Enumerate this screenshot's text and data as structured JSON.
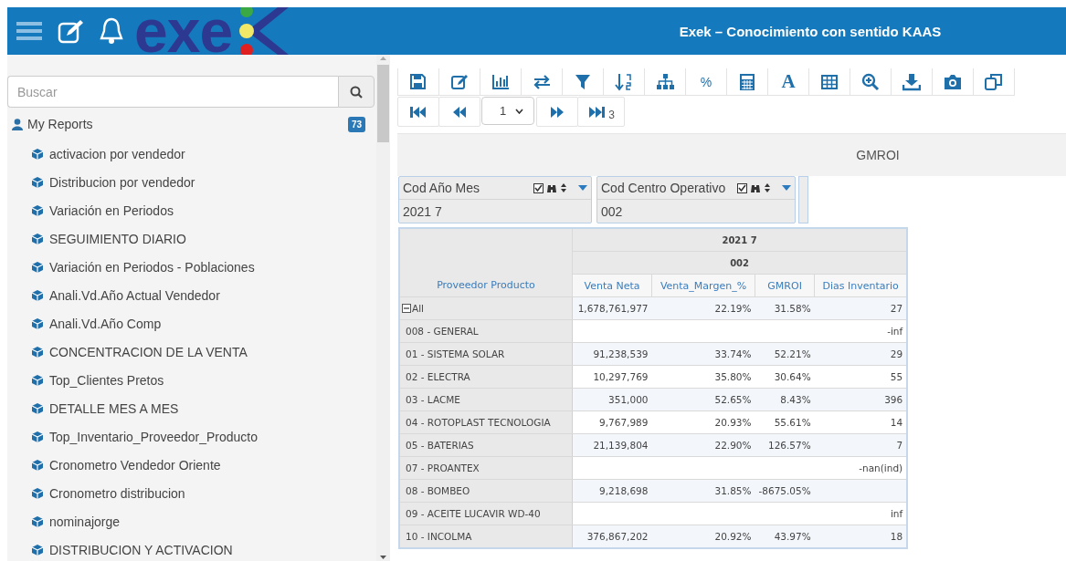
{
  "header": {
    "logo_text": "exe",
    "title": "Exek – Conocimiento con sentido KAAS"
  },
  "sidebar": {
    "search": {
      "placeholder": "Buscar"
    },
    "section": {
      "label": "My Reports",
      "count": "73"
    },
    "items": [
      {
        "label": "activacion por vendedor"
      },
      {
        "label": "Distribucion por vendedor"
      },
      {
        "label": "Variación en Periodos"
      },
      {
        "label": "SEGUIMIENTO DIARIO"
      },
      {
        "label": "Variación en Periodos - Poblaciones"
      },
      {
        "label": "Anali.Vd.Año Actual Vendedor"
      },
      {
        "label": "Anali.Vd.Año Comp"
      },
      {
        "label": "CONCENTRACION DE LA VENTA"
      },
      {
        "label": "Top_Clientes Pretos"
      },
      {
        "label": "DETALLE MES A MES"
      },
      {
        "label": "Top_Inventario_Proveedor_Producto"
      },
      {
        "label": "Cronometro Vendedor Oriente"
      },
      {
        "label": "Cronometro distribucion"
      },
      {
        "label": "nominajorge"
      },
      {
        "label": "DISTRIBUCION Y ACTIVACION"
      }
    ]
  },
  "toolbar": {
    "percent_label": "%",
    "font_label": "A"
  },
  "pager": {
    "page": "1",
    "total": "3"
  },
  "report_title": "GMROI",
  "filters": [
    {
      "label": "Cod Año Mes",
      "value": "2021 7"
    },
    {
      "label": "Cod Centro Operativo",
      "value": "002"
    }
  ],
  "table": {
    "header_rows": [
      "2021 7",
      "002"
    ],
    "row_header": "Proveedor Producto",
    "columns": [
      "Venta Neta",
      "Venta_Margen_%",
      "GMROI",
      "Dias Inventario"
    ],
    "total_row": {
      "label": "All",
      "expanded": true,
      "cells": [
        "1,678,761,977",
        "22.19%",
        "31.58%",
        "27"
      ]
    },
    "rows": [
      {
        "label": "008 - GENERAL",
        "cells": [
          "",
          "",
          "",
          "-inf"
        ]
      },
      {
        "label": "01 - SISTEMA SOLAR",
        "cells": [
          "91,238,539",
          "33.74%",
          "52.21%",
          "29"
        ]
      },
      {
        "label": "02 - ELECTRA",
        "cells": [
          "10,297,769",
          "35.80%",
          "30.64%",
          "55"
        ]
      },
      {
        "label": "03 - LACME",
        "cells": [
          "351,000",
          "52.65%",
          "8.43%",
          "396"
        ]
      },
      {
        "label": "04 - ROTOPLAST TECNOLOGIA",
        "cells": [
          "9,767,989",
          "20.93%",
          "55.61%",
          "14"
        ]
      },
      {
        "label": "05 - BATERIAS",
        "cells": [
          "21,139,804",
          "22.90%",
          "126.57%",
          "7"
        ]
      },
      {
        "label": "07 - PROANTEX",
        "cells": [
          "",
          "",
          "",
          "-nan(ind)"
        ]
      },
      {
        "label": "08 - BOMBEO",
        "cells": [
          "9,218,698",
          "31.85%",
          "-8675.05%",
          ""
        ]
      },
      {
        "label": "09 - ACEITE LUCAVIR WD-40",
        "cells": [
          "",
          "",
          "",
          "inf"
        ]
      },
      {
        "label": "10 - INCOLMA",
        "cells": [
          "376,867,202",
          "20.92%",
          "43.97%",
          "18"
        ]
      }
    ]
  }
}
